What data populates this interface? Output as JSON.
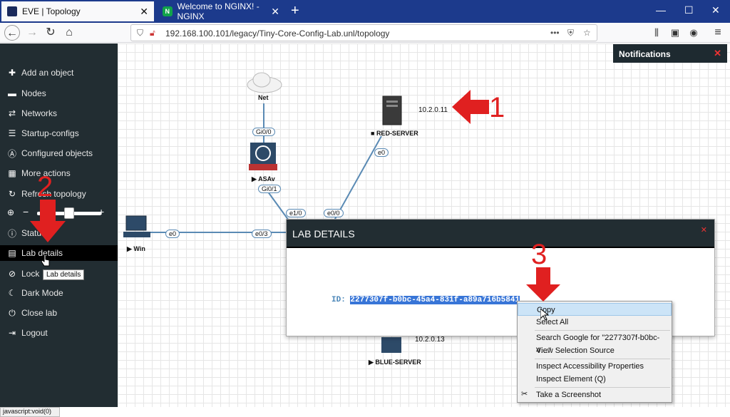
{
  "browser": {
    "tabs": [
      {
        "label": "EVE | Topology"
      },
      {
        "label": "Welcome to NGINX! - NGINX"
      }
    ],
    "url": "192.168.100.101/legacy/Tiny-Core-Config-Lab.unl/topology",
    "status_url": "javascript:void(0)"
  },
  "sidebar": {
    "items": [
      {
        "label": "Add an object",
        "icon": "plus-icon"
      },
      {
        "label": "Nodes",
        "icon": "nodes-icon"
      },
      {
        "label": "Networks",
        "icon": "networks-icon"
      },
      {
        "label": "Startup-configs",
        "icon": "startup-configs-icon"
      },
      {
        "label": "Configured objects",
        "icon": "configured-objects-icon"
      },
      {
        "label": "More actions",
        "icon": "grid-icon"
      },
      {
        "label": "Refresh topology",
        "icon": "refresh-icon"
      },
      {
        "label": "Status",
        "icon": "info-icon"
      },
      {
        "label": "Lab details",
        "icon": "list-icon"
      },
      {
        "label": "Lock",
        "icon": "lock-icon"
      },
      {
        "label": "Dark Mode",
        "icon": "moon-icon"
      },
      {
        "label": "Close lab",
        "icon": "power-icon"
      },
      {
        "label": "Logout",
        "icon": "logout-icon"
      }
    ],
    "tooltip": "Lab details"
  },
  "notifications": {
    "title": "Notifications"
  },
  "topology": {
    "nodes": {
      "net": "Net",
      "asav": "ASAv",
      "red_server": "RED-SERVER",
      "blue_server": "BLUE-SERVER",
      "win": "Win"
    },
    "interfaces": {
      "net_gi0_0": "Gi0/0",
      "asav_gi0_1": "Gi0/1",
      "red_e0": "e0",
      "sw_e1_0": "e1/0",
      "sw_e0_0": "e0/0",
      "win_e0": "e0",
      "sw_e0_3": "e0/3"
    },
    "ips": {
      "red": "10.2.0.11",
      "blue": "10.2.0.13"
    }
  },
  "modal": {
    "title": "LAB DETAILS",
    "id_label": "ID:",
    "id_value": "2277307f-b0bc-45a4-831f-a89a716b5841"
  },
  "context_menu": {
    "items": [
      "Copy",
      "Select All",
      "Search Google for \"2277307f-b0bc-4…\"",
      "View Selection Source",
      "Inspect Accessibility Properties",
      "Inspect Element (Q)",
      "Take a Screenshot"
    ]
  },
  "annotations": [
    "1",
    "2",
    "3"
  ],
  "colors": {
    "tab_bar": "#1c3a8c",
    "sidebar": "#222d32",
    "annotation": "#e02020",
    "selection": "#3875d7"
  }
}
